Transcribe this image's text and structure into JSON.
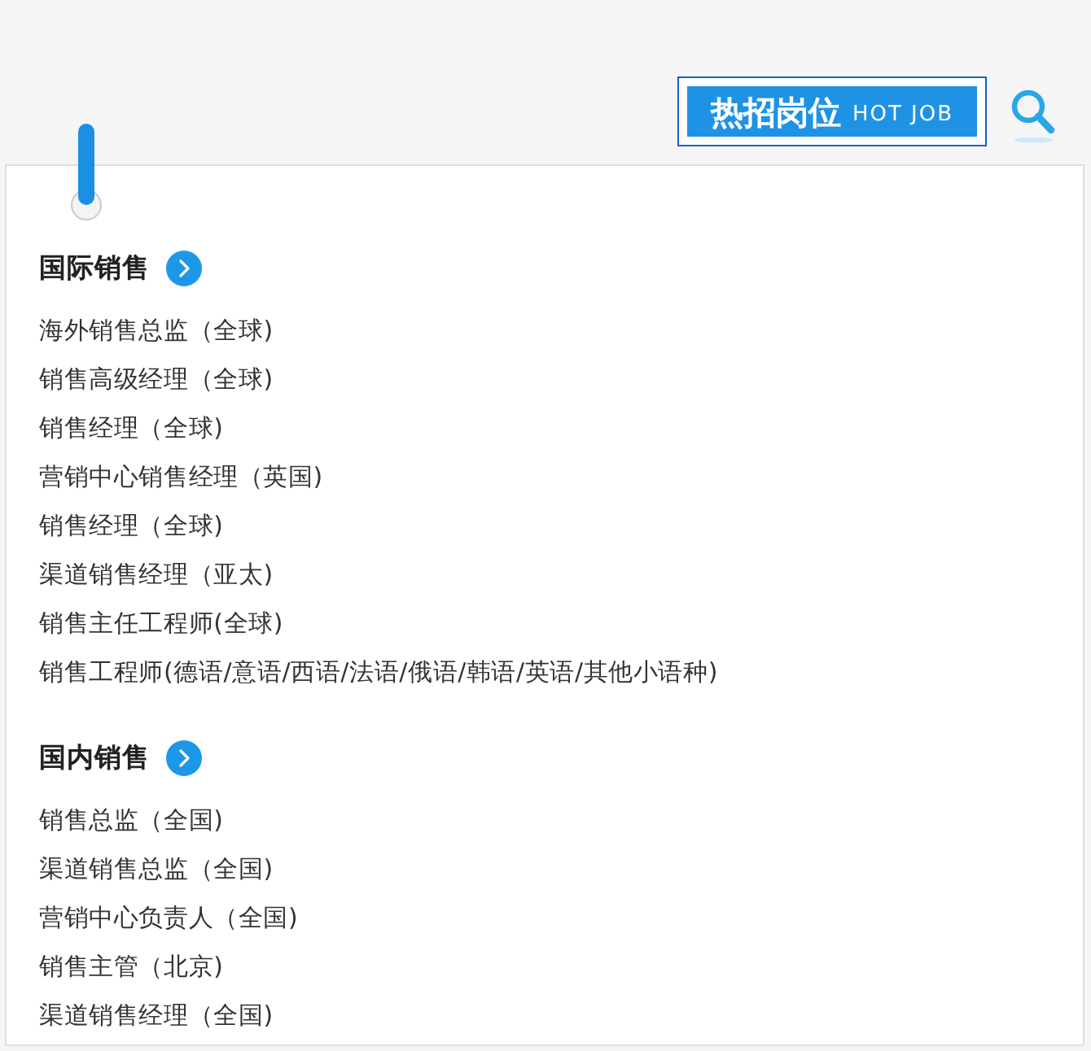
{
  "header": {
    "banner": {
      "title": "热招岗位",
      "subtitle": "HOT JOB"
    }
  },
  "sections": [
    {
      "title": "国际销售",
      "jobs": [
        "海外销售总监（全球)",
        "销售高级经理（全球)",
        "销售经理（全球)",
        "营销中心销售经理（英国)",
        "销售经理（全球)",
        "渠道销售经理（亚太)",
        "销售主任工程师(全球)",
        "销售工程师(德语/意语/西语/法语/俄语/韩语/英语/其他小语种)"
      ]
    },
    {
      "title": "国内销售",
      "jobs": [
        "销售总监（全国)",
        "渠道销售总监（全国)",
        "营销中心负责人（全国)",
        "销售主管（北京)",
        "渠道销售经理（全国)"
      ]
    }
  ]
}
